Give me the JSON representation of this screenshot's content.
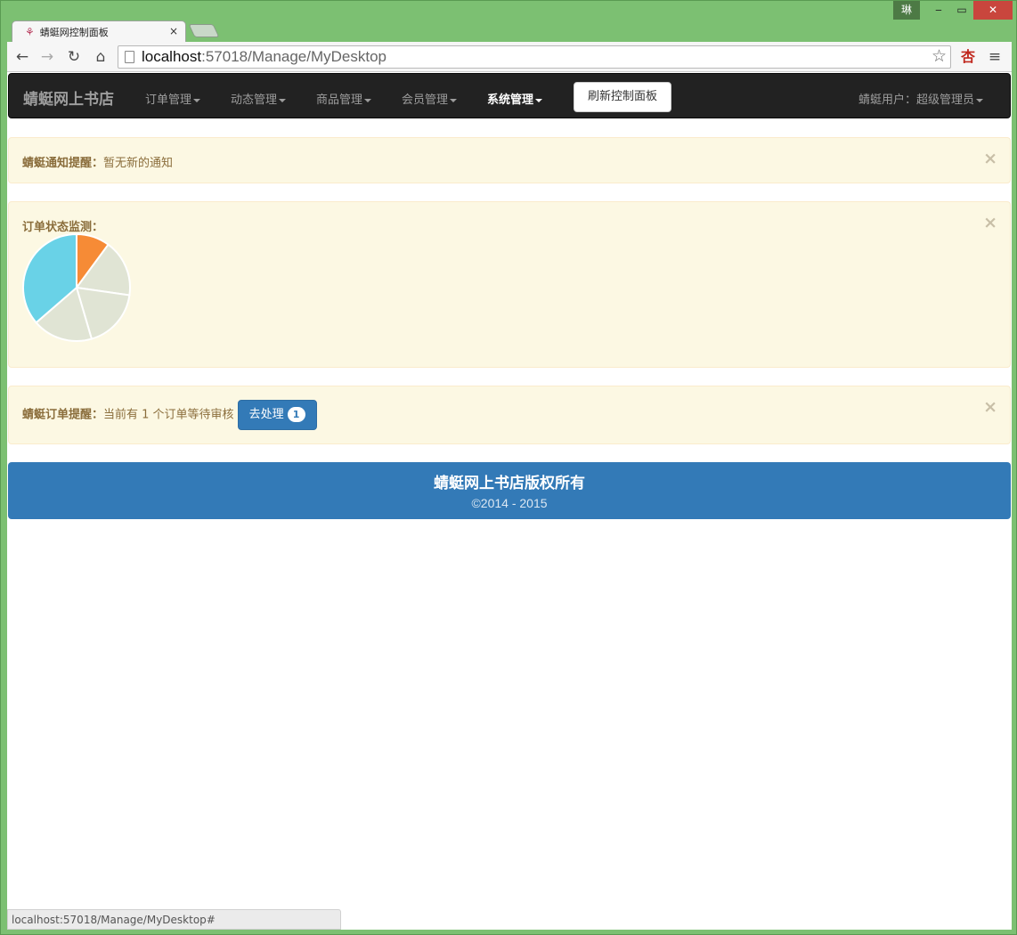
{
  "window": {
    "user_badge": "琳",
    "minimize": "‒",
    "maximize": "▭",
    "close": "✕"
  },
  "browser": {
    "tab_title": "蜻蜓网控制面板",
    "tab_close": "×",
    "url_host": "localhost",
    "url_rest": ":57018/Manage/MyDesktop",
    "icons": [
      "back-icon",
      "forward-icon",
      "reload-icon",
      "home-icon",
      "page-icon",
      "bookmark-star-icon",
      "extension-icon",
      "menu-icon"
    ],
    "extension_label": "杏",
    "status_url": "localhost:57018/Manage/MyDesktop#"
  },
  "navbar": {
    "brand": "蜻蜓网上书店",
    "items": [
      {
        "label": "订单管理",
        "active": false
      },
      {
        "label": "动态管理",
        "active": false
      },
      {
        "label": "商品管理",
        "active": false
      },
      {
        "label": "会员管理",
        "active": false
      },
      {
        "label": "系统管理",
        "active": true
      }
    ],
    "refresh_button": "刷新控制面板",
    "user_menu": "蜻蜓用户：超级管理员"
  },
  "alerts": {
    "notice": {
      "title": "蜻蜓通知提醒：",
      "text": "暂无新的通知",
      "close": "×"
    },
    "order_status": {
      "title": "订单状态监测：",
      "close": "×"
    },
    "order_reminder": {
      "title": "蜻蜓订单提醒：",
      "text": "当前有 1 个订单等待审核",
      "button_label": "去处理",
      "badge_count": "1",
      "close": "×"
    }
  },
  "chart_data": {
    "type": "pie",
    "values": [
      10,
      17,
      18,
      18,
      36
    ],
    "colors": [
      "#f68b36",
      "#e0e4d4",
      "#e0e4d4",
      "#e0e4d4",
      "#69d2e7"
    ]
  },
  "footer": {
    "title": "蜻蜓网上书店版权所有",
    "copyright": "©2014 - 2015"
  },
  "colors": {
    "navbar_bg": "#222222",
    "alert_bg": "#fcf8e3",
    "alert_text": "#8a6d3b",
    "primary": "#337ab7"
  }
}
